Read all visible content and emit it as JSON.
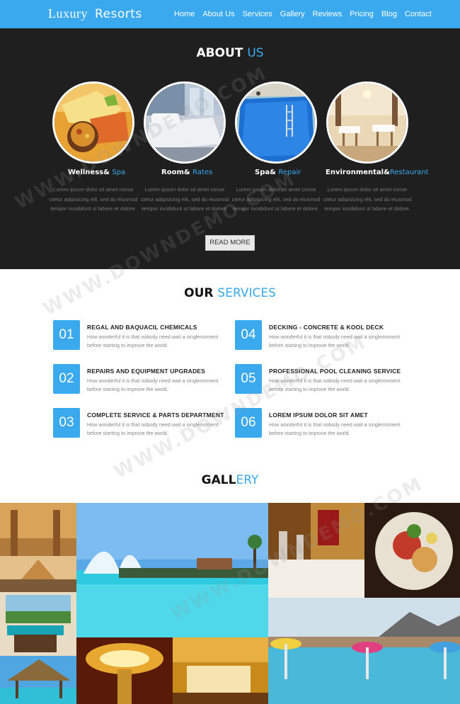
{
  "nav": {
    "logo_part1": "Luxury",
    "logo_part2": "Resorts",
    "items": [
      "Home",
      "About Us",
      "Services",
      "Gallery",
      "Reviews",
      "Pricing",
      "Blog",
      "Contact"
    ]
  },
  "about": {
    "title_main": "ABOUT",
    "title_accent": "US",
    "features": [
      {
        "title": "Wellness&",
        "accent": "Spa",
        "text": "Lorem ipsum dolor sit amet conse ctetur adipisicing elit, sed do eiusmod tempor incididunt ut labore et dolore."
      },
      {
        "title": "Room&",
        "accent": "Rates",
        "text": "Lorem ipsum dolor sit amet conse ctetur adipisicing elit, sed do eiusmod tempor incididunt ut labore et dolore."
      },
      {
        "title": "Spa&",
        "accent": "Repair",
        "text": "Lorem ipsum dolor sit amet conse ctetur adipisicing elit, sed do eiusmod tempor incididunt ut labore et dolore."
      },
      {
        "title": "Environmental&",
        "accent": "Restaurant",
        "text": "Lorem ipsum dolor sit amet conse ctetur adipisicing elit, sed do eiusmod tempor incididunt ut labore et dolore."
      }
    ],
    "read_more": "READ MORE"
  },
  "services": {
    "title_main": "OUR",
    "title_accent": "SERVICES",
    "items": [
      {
        "num": "01",
        "title": "REGAL AND BAQUACIL CHEMICALS",
        "desc": "How wonderful it is that nobody need wait a singlemoment before starting to improve the world."
      },
      {
        "num": "04",
        "title": "DECKING - CONCRETE & KOOL DECK",
        "desc": "How wonderful it is that nobody need wait a singlemoment before starting to improve the world."
      },
      {
        "num": "02",
        "title": "REPAIRS AND EQUIPMENT UPGRADES",
        "desc": "How wonderful it is that nobody need wait a singlemoment before starting to improve the world."
      },
      {
        "num": "05",
        "title": "PROFESSIONAL POOL CLEANING SERVICE",
        "desc": "How wonderful it is that nobody need wait a singlemoment before starting to improve the world."
      },
      {
        "num": "03",
        "title": "COMPLETE SERVICE & PARTS DEPARTMENT",
        "desc": "How wonderful it is that nobody need wait a singlemoment before starting to improve the world."
      },
      {
        "num": "06",
        "title": "LOREM IPSUM DOLOR SIT AMET",
        "desc": "How wonderful it is that nobody need wait a singlemoment before starting to improve the world."
      }
    ]
  },
  "gallery": {
    "title_main": "GALL",
    "title_accent": "ERY"
  },
  "watermark": "WWW.DOWNDEMO.COM",
  "colors": {
    "accent": "#3aa9ee",
    "dark": "#1f1f1f"
  }
}
